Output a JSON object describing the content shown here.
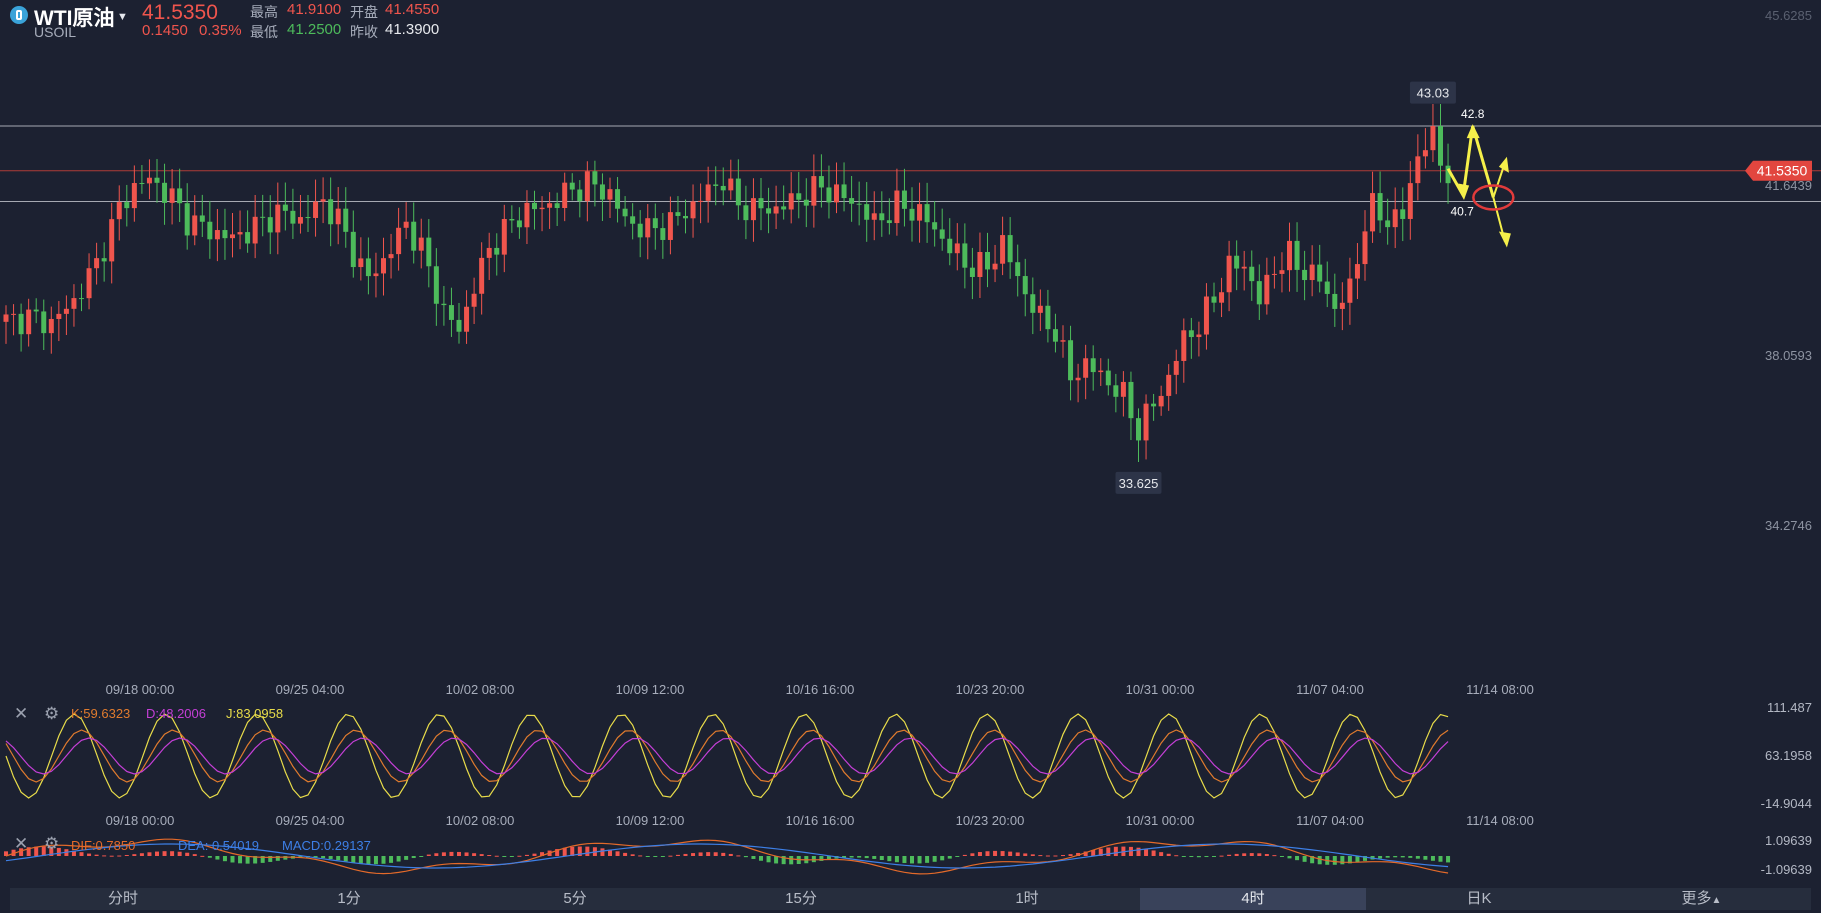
{
  "instrument": {
    "name": "WTI原油",
    "code": "USOIL",
    "last": "41.5350",
    "change": "0.1450",
    "change_pct": "0.35%"
  },
  "quote": {
    "high_label": "最高",
    "high": "41.9100",
    "open_label": "开盘",
    "open": "41.4550",
    "low_label": "最低",
    "low": "41.2500",
    "prev_close_label": "昨收",
    "prev_close": "41.3900"
  },
  "colors": {
    "background": "#1c2131",
    "up": "#f0554d",
    "down": "#4dbb5b",
    "k_line": "#e07b2e",
    "d_line": "#c43fd6",
    "j_line": "#e8dc4a",
    "dif_line": "#e46a2a",
    "dea_line": "#3d7fe6",
    "annotation": "#f5f04a"
  },
  "price_axis": {
    "ticks": [
      "45.6285",
      "41.6439",
      "38.0593",
      "34.2746"
    ]
  },
  "time_axis": {
    "labels": [
      "09/18 00:00",
      "09/25 04:00",
      "10/02 08:00",
      "10/09 12:00",
      "10/16 16:00",
      "10/23 20:00",
      "10/31 00:00",
      "11/07 04:00",
      "11/14 08:00"
    ]
  },
  "kdj": {
    "k_label": "K:59.6323",
    "d_label": "D:48.2006",
    "j_label": "J:83.0958",
    "axis_ticks": [
      "111.487",
      "63.1958",
      "-14.9044"
    ]
  },
  "macd": {
    "dif_label": "DIF:0.7850",
    "dea_label": "DEA: 0.54019",
    "macd_label": "MACD:0.29137",
    "axis_ticks": [
      "1.09639",
      "-1.09639"
    ]
  },
  "tabs": [
    {
      "label": "分时",
      "active": false
    },
    {
      "label": "1分",
      "active": false
    },
    {
      "label": "5分",
      "active": false
    },
    {
      "label": "15分",
      "active": false
    },
    {
      "label": "1时",
      "active": false
    },
    {
      "label": "4时",
      "active": true
    },
    {
      "label": "日K",
      "active": false
    },
    {
      "label": "更多",
      "active": false
    }
  ],
  "more_caret": "▲",
  "chart_data": {
    "type": "candlestick",
    "timeframe": "4时",
    "ylim": [
      30.2,
      45.6285
    ],
    "x_labels": [
      "09/18 00:00",
      "09/25 04:00",
      "10/02 08:00",
      "10/09 12:00",
      "10/16 16:00",
      "10/23 20:00",
      "10/31 00:00",
      "11/07 04:00",
      "11/14 08:00"
    ],
    "anchors": [
      {
        "x": 0,
        "y": 37.45
      },
      {
        "x": 3,
        "y": 37.55
      },
      {
        "x": 6,
        "y": 37.4
      },
      {
        "x": 9,
        "y": 38.0
      },
      {
        "x": 12,
        "y": 39.0
      },
      {
        "x": 15,
        "y": 40.5
      },
      {
        "x": 17,
        "y": 41.1
      },
      {
        "x": 19,
        "y": 41.3
      },
      {
        "x": 22,
        "y": 40.8
      },
      {
        "x": 24,
        "y": 40.2
      },
      {
        "x": 27,
        "y": 39.9
      },
      {
        "x": 30,
        "y": 39.7
      },
      {
        "x": 33,
        "y": 40.0
      },
      {
        "x": 36,
        "y": 40.4
      },
      {
        "x": 39,
        "y": 40.2
      },
      {
        "x": 42,
        "y": 40.7
      },
      {
        "x": 44,
        "y": 40.2
      },
      {
        "x": 46,
        "y": 39.3
      },
      {
        "x": 48,
        "y": 38.6
      },
      {
        "x": 50,
        "y": 39.1
      },
      {
        "x": 53,
        "y": 40.1
      },
      {
        "x": 55,
        "y": 39.4
      },
      {
        "x": 58,
        "y": 37.7
      },
      {
        "x": 60,
        "y": 37.2
      },
      {
        "x": 62,
        "y": 38.4
      },
      {
        "x": 64,
        "y": 39.4
      },
      {
        "x": 66,
        "y": 39.9
      },
      {
        "x": 69,
        "y": 40.5
      },
      {
        "x": 71,
        "y": 40.5
      },
      {
        "x": 74,
        "y": 40.9
      },
      {
        "x": 77,
        "y": 41.2
      },
      {
        "x": 80,
        "y": 40.9
      },
      {
        "x": 82,
        "y": 40.2
      },
      {
        "x": 85,
        "y": 39.9
      },
      {
        "x": 88,
        "y": 40.1
      },
      {
        "x": 91,
        "y": 40.6
      },
      {
        "x": 93,
        "y": 41.0
      },
      {
        "x": 95,
        "y": 41.3
      },
      {
        "x": 97,
        "y": 40.6
      },
      {
        "x": 99,
        "y": 40.5
      },
      {
        "x": 102,
        "y": 40.5
      },
      {
        "x": 105,
        "y": 40.8
      },
      {
        "x": 108,
        "y": 41.1
      },
      {
        "x": 110,
        "y": 40.9
      },
      {
        "x": 113,
        "y": 40.6
      },
      {
        "x": 115,
        "y": 40.1
      },
      {
        "x": 118,
        "y": 40.6
      },
      {
        "x": 121,
        "y": 40.4
      },
      {
        "x": 124,
        "y": 39.7
      },
      {
        "x": 127,
        "y": 39.0
      },
      {
        "x": 130,
        "y": 38.9
      },
      {
        "x": 132,
        "y": 39.6
      },
      {
        "x": 134,
        "y": 38.6
      },
      {
        "x": 137,
        "y": 37.5
      },
      {
        "x": 139,
        "y": 37.2
      },
      {
        "x": 141,
        "y": 35.9
      },
      {
        "x": 143,
        "y": 36.3
      },
      {
        "x": 146,
        "y": 35.8
      },
      {
        "x": 148,
        "y": 35.4
      },
      {
        "x": 150,
        "y": 34.5
      },
      {
        "x": 152,
        "y": 35.2
      },
      {
        "x": 154,
        "y": 35.9
      },
      {
        "x": 156,
        "y": 37.0
      },
      {
        "x": 158,
        "y": 37.3
      },
      {
        "x": 160,
        "y": 38.1
      },
      {
        "x": 162,
        "y": 38.9
      },
      {
        "x": 164,
        "y": 39.0
      },
      {
        "x": 166,
        "y": 38.0
      },
      {
        "x": 168,
        "y": 38.9
      },
      {
        "x": 170,
        "y": 39.2
      },
      {
        "x": 172,
        "y": 38.8
      },
      {
        "x": 174,
        "y": 38.6
      },
      {
        "x": 176,
        "y": 37.8
      },
      {
        "x": 178,
        "y": 38.3
      },
      {
        "x": 180,
        "y": 40.1
      },
      {
        "x": 181,
        "y": 40.5
      },
      {
        "x": 183,
        "y": 40.2
      },
      {
        "x": 185,
        "y": 40.3
      },
      {
        "x": 187,
        "y": 42.0
      },
      {
        "x": 189,
        "y": 42.4
      },
      {
        "x": 191,
        "y": 41.4
      }
    ],
    "high_marker": {
      "label": "43.03",
      "value": 43.03
    },
    "low_marker": {
      "label": "33.625",
      "value": 33.625
    },
    "horizontal_lines": [
      42.75,
      41.535,
      40.7
    ],
    "annotations": {
      "labels": [
        "42.8",
        "40.7"
      ],
      "upper_target": 42.8,
      "lower_target": 40.7
    }
  }
}
